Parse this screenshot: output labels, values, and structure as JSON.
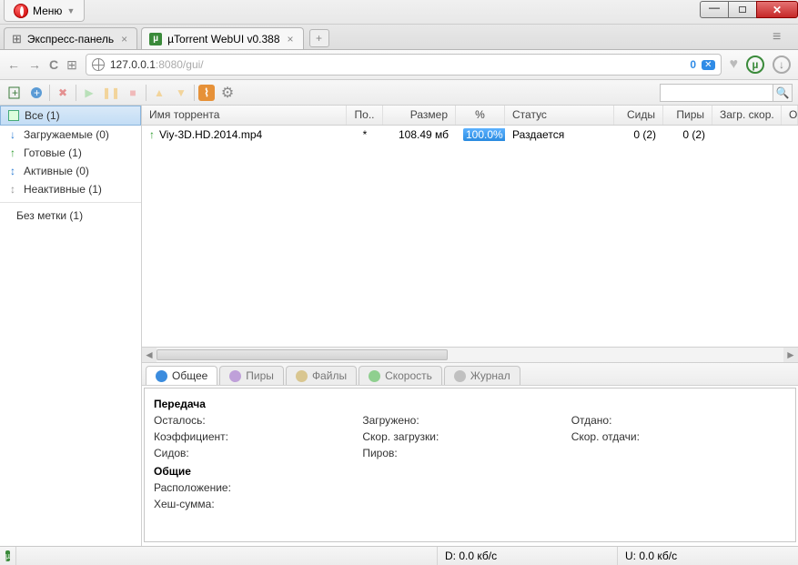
{
  "window": {
    "menu_label": "Меню"
  },
  "tabs": {
    "items": [
      {
        "label": "Экспресс-панель"
      },
      {
        "label": "µTorrent WebUI v0.388"
      }
    ]
  },
  "address": {
    "host": "127.0.0.1",
    "port_path": ":8080/gui/",
    "badge_count": "0"
  },
  "sidebar": {
    "items": [
      {
        "label": "Все (1)"
      },
      {
        "label": "Загружаемые (0)"
      },
      {
        "label": "Готовые (1)"
      },
      {
        "label": "Активные (0)"
      },
      {
        "label": "Неактивные (1)"
      }
    ],
    "nolabel": "Без метки (1)"
  },
  "columns": {
    "name": "Имя торрента",
    "done": "По..",
    "size": "Размер",
    "pct": "%",
    "status": "Статус",
    "seeds": "Сиды",
    "peers": "Пиры",
    "dspeed": "Загр. скор.",
    "extra": "О"
  },
  "torrents": [
    {
      "name": "Viy-3D.HD.2014.mp4",
      "done": "*",
      "size": "108.49 мб",
      "pct": "100.0%",
      "status": "Раздается",
      "seeds": "0 (2)",
      "peers": "0 (2)"
    }
  ],
  "detail_tabs": {
    "general": "Общее",
    "peers": "Пиры",
    "files": "Файлы",
    "speed": "Скорость",
    "log": "Журнал"
  },
  "details": {
    "transfer_title": "Передача",
    "remaining": "Осталось:",
    "downloaded": "Загружено:",
    "uploaded": "Отдано:",
    "ratio": "Коэффициент:",
    "dl_speed": "Скор. загрузки:",
    "ul_speed": "Скор. отдачи:",
    "seeds": "Сидов:",
    "peers": "Пиров:",
    "general_title": "Общие",
    "location": "Расположение:",
    "hash": "Хеш-сумма:"
  },
  "statusbar": {
    "dl": "D: 0.0 кб/с",
    "ul": "U: 0.0 кб/с"
  }
}
